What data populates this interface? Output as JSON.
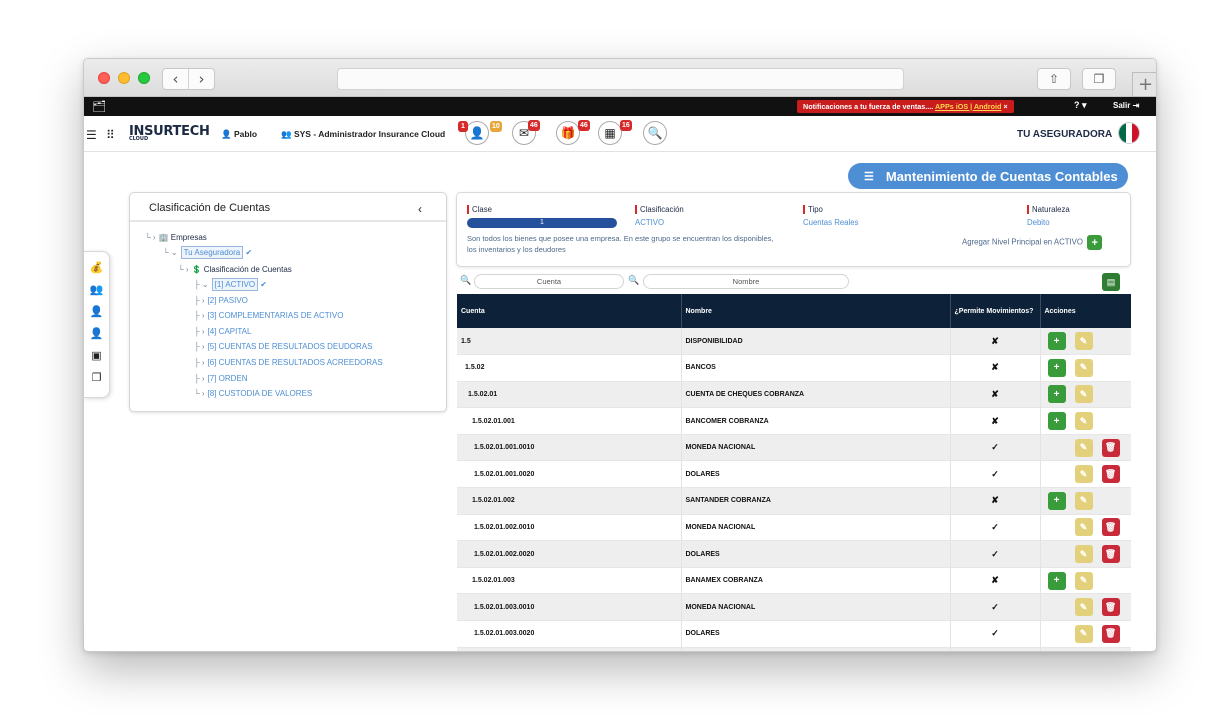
{
  "browser": {
    "back": "‹",
    "forward": "›"
  },
  "topbar": {
    "notification_text": "Notificaciones a tu fuerza de ventas....",
    "apps_link": "APPs iOS | Android",
    "notification_close": "×",
    "help": "?",
    "logout": "Salir"
  },
  "header": {
    "logo": "INSURTECH",
    "logo_sub": "CLOUD",
    "user": "Pablo",
    "role": "SYS - Administrador Insurance Cloud",
    "badges": {
      "users_left": "1",
      "users_right": "10",
      "mail": "46",
      "gift": "46",
      "calendar": "16"
    },
    "company": "TU ASEGURADORA",
    "flag_colors": [
      "#006847",
      "#ffffff",
      "#ce1126"
    ]
  },
  "page_button": "Mantenimiento de Cuentas Contables",
  "tree": {
    "title": "Clasificación de Cuentas",
    "empresas": "Empresas",
    "tu_aseguradora": "Tu Aseguradora",
    "clasificacion": "Clasificación de Cuentas",
    "items": [
      "[1] ACTIVO",
      "[2] PASIVO",
      "[3] COMPLEMENTARIAS DE ACTIVO",
      "[4] CAPITAL",
      "[5] CUENTAS DE RESULTADOS DEUDORAS",
      "[6] CUENTAS DE RESULTADOS ACREEDORAS",
      "[7] ORDEN",
      "[8] CUSTODIA DE VALORES"
    ]
  },
  "info": {
    "clase_label": "Clase",
    "clase_value": "1",
    "clasificacion_label": "Clasificación",
    "clasificacion_value": "ACTIVO",
    "tipo_label": "Tipo",
    "tipo_value": "Cuentas Reales",
    "naturaleza_label": "Naturaleza",
    "naturaleza_value": "Debito",
    "description_1": "Son todos los bienes que posee una empresa. En este grupo se encuentran los disponibles,",
    "description_2": "los inventarios y los deudores",
    "add_label": "Agregar Nivel Principal en ACTIVO"
  },
  "search": {
    "cuenta_placeholder": "Cuenta",
    "nombre_placeholder": "Nombre"
  },
  "table": {
    "headers": [
      "Cuenta",
      "Nombre",
      "¿Permite Movimientos?",
      "Acciones"
    ],
    "rows": [
      {
        "cuenta": "1.5",
        "nombre": "DISPONIBILIDAD",
        "mov": "✘",
        "indent": 0
      },
      {
        "cuenta": "1.5.02",
        "nombre": "BANCOS",
        "mov": "✘",
        "indent": 1
      },
      {
        "cuenta": "1.5.02.01",
        "nombre": "CUENTA DE CHEQUES COBRANZA",
        "mov": "✘",
        "indent": 2
      },
      {
        "cuenta": "1.5.02.01.001",
        "nombre": "BANCOMER COBRANZA",
        "mov": "✘",
        "indent": 3
      },
      {
        "cuenta": "1.5.02.01.001.0010",
        "nombre": "MONEDA NACIONAL",
        "mov": "✓",
        "indent": 4
      },
      {
        "cuenta": "1.5.02.01.001.0020",
        "nombre": "DOLARES",
        "mov": "✓",
        "indent": 4
      },
      {
        "cuenta": "1.5.02.01.002",
        "nombre": "SANTANDER COBRANZA",
        "mov": "✘",
        "indent": 3
      },
      {
        "cuenta": "1.5.02.01.002.0010",
        "nombre": "MONEDA NACIONAL",
        "mov": "✓",
        "indent": 4
      },
      {
        "cuenta": "1.5.02.01.002.0020",
        "nombre": "DOLARES",
        "mov": "✓",
        "indent": 4
      },
      {
        "cuenta": "1.5.02.01.003",
        "nombre": "BANAMEX COBRANZA",
        "mov": "✘",
        "indent": 3
      },
      {
        "cuenta": "1.5.02.01.003.0010",
        "nombre": "MONEDA NACIONAL",
        "mov": "✓",
        "indent": 4
      },
      {
        "cuenta": "1.5.02.01.003.0020",
        "nombre": "DOLARES",
        "mov": "✓",
        "indent": 4
      },
      {
        "cuenta": "",
        "nombre": "",
        "mov": "",
        "indent": 3
      }
    ]
  }
}
